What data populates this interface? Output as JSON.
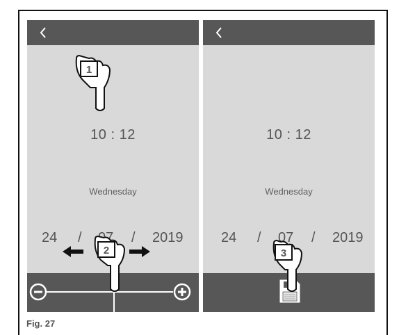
{
  "left_panel": {
    "time": "10 : 12",
    "day": "Wednesday",
    "date": {
      "day": "24",
      "month": "07",
      "year": "2019",
      "separator": "/"
    },
    "step_marker_top": "1",
    "step_marker_bottom": "2",
    "slider": {
      "minus_icon": "minus-circle-icon",
      "plus_icon": "plus-circle-icon",
      "value_fraction": 0.5
    }
  },
  "right_panel": {
    "time": "10 : 12",
    "day": "Wednesday",
    "date": {
      "day": "24",
      "month": "07",
      "year": "2019",
      "separator": "/"
    },
    "step_marker": "3",
    "save_icon": "floppy-disk-icon"
  },
  "caption": "Fig. 27",
  "colors": {
    "bar": "#575757",
    "screen": "#d9d9d9",
    "text": "#555555"
  }
}
